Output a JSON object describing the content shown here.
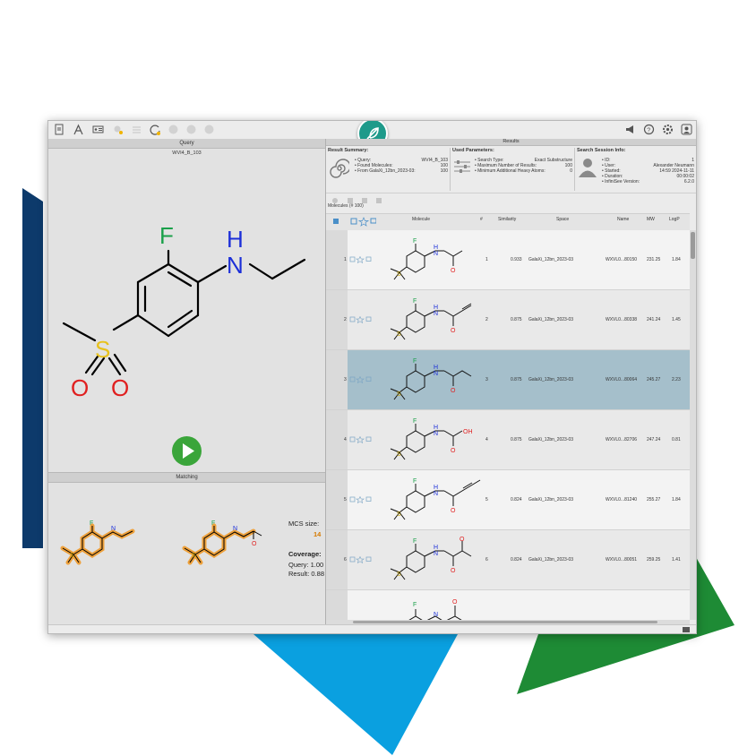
{
  "query": {
    "panel_title": "Query",
    "compound_name": "WVI4_B_103",
    "run_icon": "play-icon"
  },
  "matching": {
    "panel_title": "Matching",
    "mcs_label": "MCS size:",
    "mcs_value": "14",
    "coverage_label": "Coverage:",
    "coverage_query": "Query: 1.00",
    "coverage_result": "Result: 0.88"
  },
  "results": {
    "panel_title": "Results",
    "summary": {
      "title": "Result Summary:",
      "query_label": "• Query:",
      "query_value": "WVI4_B_103",
      "found_label": "• Found Molecules:",
      "found_value": "100",
      "from_label": "• From GalaXi_12bn_2023-03:",
      "from_value": "100"
    },
    "params": {
      "title": "Used Parameters:",
      "type_label": "• Search Type:",
      "type_value": "Exact Substructure",
      "max_label": "• Maximum Number of Results:",
      "max_value": "100",
      "min_label": "• Minimum Additional Heavy Atoms:",
      "min_value": "0"
    },
    "session": {
      "title": "Search Session Info:",
      "id_label": "• ID:",
      "id_value": "1",
      "user_label": "• User:",
      "user_value": "Alexander Neumann",
      "started_label": "• Started:",
      "started_value": "14:59 2024-11-11",
      "duration_label": "• Duration:",
      "duration_value": "00:00:02",
      "version_label": "• InfiniSee Version:",
      "version_value": "6.2.0"
    },
    "molecules_count": "Molecules (# 100)",
    "columns": [
      "Molecule",
      "#",
      "Similarity",
      "Space",
      "Name",
      "MW",
      "LogP"
    ],
    "rows": [
      {
        "index": "1",
        "rank": "1",
        "similarity": "0.933",
        "space": "GalaXi_12bn_2023-03",
        "name": "WXVL0...80150",
        "mw": "231.25",
        "logp": "1.84",
        "substituent": "acetamide",
        "selected": false
      },
      {
        "index": "2",
        "rank": "2",
        "similarity": "0.875",
        "space": "GalaXi_12bn_2023-03",
        "name": "WXVL0...80338",
        "mw": "241.24",
        "logp": "1.45",
        "substituent": "propiolamide",
        "selected": false
      },
      {
        "index": "3",
        "rank": "3",
        "similarity": "0.875",
        "space": "GalaXi_12bn_2023-03",
        "name": "WXVL0...80064",
        "mw": "245.27",
        "logp": "2.23",
        "substituent": "propanamide",
        "selected": true
      },
      {
        "index": "4",
        "rank": "4",
        "similarity": "0.875",
        "space": "GalaXi_12bn_2023-03",
        "name": "WXVL0...82706",
        "mw": "247.24",
        "logp": "0.81",
        "substituent": "hydroxyacetamide",
        "selected": false
      },
      {
        "index": "5",
        "rank": "5",
        "similarity": "0.824",
        "space": "GalaXi_12bn_2023-03",
        "name": "WXVL0...81240",
        "mw": "255.27",
        "logp": "1.84",
        "substituent": "butynamide",
        "selected": false
      },
      {
        "index": "6",
        "rank": "6",
        "similarity": "0.824",
        "space": "GalaXi_12bn_2023-03",
        "name": "WXVL0...80051",
        "mw": "259.25",
        "logp": "1.41",
        "substituent": "oxopropanamide",
        "selected": false
      }
    ],
    "partial_row_label": "NH₂"
  },
  "atoms": {
    "F": "F",
    "N": "N",
    "H": "H",
    "S": "S",
    "O": "O",
    "OH": "OH"
  },
  "colors": {
    "accent_teal": "#1e9a8a",
    "selected_row": "#a5bfcb",
    "run_green": "#3aa53a",
    "highlight_orange": "#f09a2a",
    "deco_navy": "#0d3a6b",
    "deco_blue": "#0aa0e0",
    "deco_green": "#1e8b35"
  }
}
